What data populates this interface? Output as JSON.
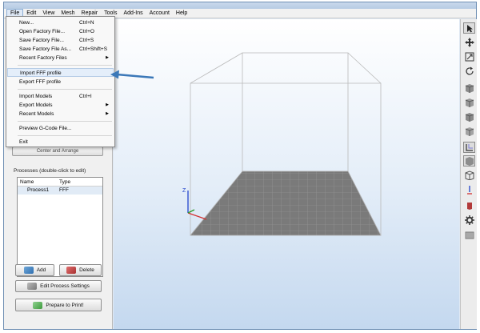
{
  "menubar": {
    "items": [
      "File",
      "Edit",
      "View",
      "Mesh",
      "Repair",
      "Tools",
      "Add-Ins",
      "Account",
      "Help"
    ]
  },
  "file_menu": {
    "new": {
      "label": "New...",
      "shortcut": "Ctrl+N"
    },
    "open_factory": {
      "label": "Open Factory File...",
      "shortcut": "Ctrl+O"
    },
    "save_factory": {
      "label": "Save Factory File...",
      "shortcut": "Ctrl+S"
    },
    "save_factory_as": {
      "label": "Save Factory File As...",
      "shortcut": "Ctrl+Shift+S"
    },
    "recent_factory": {
      "label": "Recent Factory Files"
    },
    "import_fff": {
      "label": "Import FFF profile"
    },
    "export_fff": {
      "label": "Export FFF profile"
    },
    "import_models": {
      "label": "Import Models",
      "shortcut": "Ctrl+I"
    },
    "export_models": {
      "label": "Export Models"
    },
    "recent_models": {
      "label": "Recent Models"
    },
    "preview_gcode": {
      "label": "Preview G-Code File..."
    },
    "exit": {
      "label": "Exit"
    }
  },
  "left_panel": {
    "machine_button_label": "Center and Arrange",
    "processes_label": "Processes (double-click to edit)",
    "columns": [
      "Name",
      "Type"
    ],
    "rows": [
      {
        "name": "Process1",
        "type": "FFF"
      }
    ],
    "add_label": "Add",
    "delete_label": "Delete",
    "edit_settings_label": "Edit Process Settings",
    "prepare_label": "Prepare to Print!"
  },
  "viewport": {
    "axis_z_label": "Z"
  },
  "toolbar_icons": [
    "cursor-icon",
    "move-icon",
    "scale-icon",
    "rotate-icon",
    "cube-front-icon",
    "cube-top-icon",
    "cube-right-icon",
    "cube-left-icon",
    "camera-icon",
    "cube-solid-icon",
    "cube-wire-icon",
    "axis-icon",
    "object-icon",
    "gear-icon",
    "stack-icon"
  ],
  "colors": {
    "accent_arrow": "#3b78b8",
    "build_plate": "#7a7a7a",
    "menu_highlight": "#e4eefa"
  }
}
